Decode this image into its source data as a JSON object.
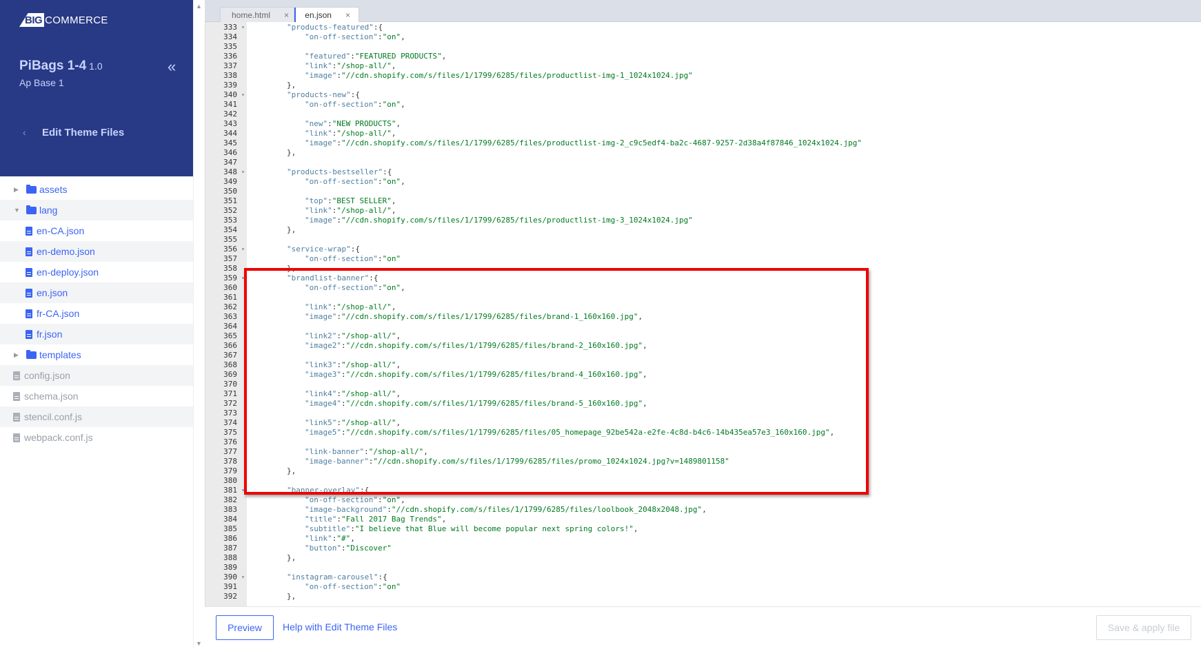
{
  "brand": {
    "logo_big": "BIG",
    "logo_rest": "COMMERCE"
  },
  "store": {
    "name": "PiBags 1-4",
    "version": "1.0",
    "subtitle": "Ap Base 1",
    "collapse_icon": "«"
  },
  "nav": {
    "back_icon": "‹",
    "title": "Edit Theme Files"
  },
  "tree": [
    {
      "label": "assets",
      "type": "folder",
      "state": "collapsed",
      "level": 0
    },
    {
      "label": "lang",
      "type": "folder",
      "state": "expanded",
      "level": 0
    },
    {
      "label": "en-CA.json",
      "type": "file",
      "level": 1
    },
    {
      "label": "en-demo.json",
      "type": "file",
      "level": 1
    },
    {
      "label": "en-deploy.json",
      "type": "file",
      "level": 1
    },
    {
      "label": "en.json",
      "type": "file",
      "level": 1
    },
    {
      "label": "fr-CA.json",
      "type": "file",
      "level": 1
    },
    {
      "label": "fr.json",
      "type": "file",
      "level": 1
    },
    {
      "label": "templates",
      "type": "folder",
      "state": "collapsed",
      "level": 0
    },
    {
      "label": "config.json",
      "type": "file-disabled",
      "level": 0
    },
    {
      "label": "schema.json",
      "type": "file-disabled",
      "level": 0
    },
    {
      "label": "stencil.conf.js",
      "type": "file-disabled",
      "level": 0
    },
    {
      "label": "webpack.conf.js",
      "type": "file-disabled",
      "level": 0
    }
  ],
  "tabs": [
    {
      "label": "home.html",
      "active": false,
      "close": "×"
    },
    {
      "label": "en.json",
      "active": true,
      "close": "×"
    }
  ],
  "code_lines": [
    {
      "n": "333",
      "fold": true,
      "ind": 1,
      "text": "\"products-featured\":{"
    },
    {
      "n": "334",
      "ind": 2,
      "text": "\"on-off-section\":\"on\","
    },
    {
      "n": "335",
      "ind": 0,
      "text": ""
    },
    {
      "n": "336",
      "ind": 2,
      "text": "\"featured\":\"FEATURED PRODUCTS\","
    },
    {
      "n": "337",
      "ind": 2,
      "text": "\"link\":\"/shop-all/\","
    },
    {
      "n": "338",
      "ind": 2,
      "text": "\"image\":\"//cdn.shopify.com/s/files/1/1799/6285/files/productlist-img-1_1024x1024.jpg\""
    },
    {
      "n": "339",
      "ind": 1,
      "text": "},"
    },
    {
      "n": "340",
      "fold": true,
      "ind": 1,
      "text": "\"products-new\":{"
    },
    {
      "n": "341",
      "ind": 2,
      "text": "\"on-off-section\":\"on\","
    },
    {
      "n": "342",
      "ind": 0,
      "text": ""
    },
    {
      "n": "343",
      "ind": 2,
      "text": "\"new\":\"NEW PRODUCTS\","
    },
    {
      "n": "344",
      "ind": 2,
      "text": "\"link\":\"/shop-all/\","
    },
    {
      "n": "345",
      "ind": 2,
      "text": "\"image\":\"//cdn.shopify.com/s/files/1/1799/6285/files/productlist-img-2_c9c5edf4-ba2c-4687-9257-2d38a4f87846_1024x1024.jpg\""
    },
    {
      "n": "346",
      "ind": 1,
      "text": "},"
    },
    {
      "n": "347",
      "ind": 0,
      "text": ""
    },
    {
      "n": "348",
      "fold": true,
      "ind": 1,
      "text": "\"products-bestseller\":{"
    },
    {
      "n": "349",
      "ind": 2,
      "text": "\"on-off-section\":\"on\","
    },
    {
      "n": "350",
      "ind": 0,
      "text": ""
    },
    {
      "n": "351",
      "ind": 2,
      "text": "\"top\":\"BEST SELLER\","
    },
    {
      "n": "352",
      "ind": 2,
      "text": "\"link\":\"/shop-all/\","
    },
    {
      "n": "353",
      "ind": 2,
      "text": "\"image\":\"//cdn.shopify.com/s/files/1/1799/6285/files/productlist-img-3_1024x1024.jpg\""
    },
    {
      "n": "354",
      "ind": 1,
      "text": "},"
    },
    {
      "n": "355",
      "ind": 0,
      "text": ""
    },
    {
      "n": "356",
      "fold": true,
      "ind": 1,
      "text": "\"service-wrap\":{"
    },
    {
      "n": "357",
      "ind": 2,
      "text": "\"on-off-section\":\"on\""
    },
    {
      "n": "358",
      "ind": 1,
      "text": "},"
    },
    {
      "n": "359",
      "fold": true,
      "ind": 1,
      "text": "\"brandlist-banner\":{"
    },
    {
      "n": "360",
      "ind": 2,
      "text": "\"on-off-section\":\"on\","
    },
    {
      "n": "361",
      "ind": 0,
      "text": ""
    },
    {
      "n": "362",
      "ind": 2,
      "text": "\"link\":\"/shop-all/\","
    },
    {
      "n": "363",
      "ind": 2,
      "text": "\"image\":\"//cdn.shopify.com/s/files/1/1799/6285/files/brand-1_160x160.jpg\","
    },
    {
      "n": "364",
      "ind": 0,
      "text": ""
    },
    {
      "n": "365",
      "ind": 2,
      "text": "\"link2\":\"/shop-all/\","
    },
    {
      "n": "366",
      "ind": 2,
      "text": "\"image2\":\"//cdn.shopify.com/s/files/1/1799/6285/files/brand-2_160x160.jpg\","
    },
    {
      "n": "367",
      "ind": 0,
      "text": ""
    },
    {
      "n": "368",
      "ind": 2,
      "text": "\"link3\":\"/shop-all/\","
    },
    {
      "n": "369",
      "ind": 2,
      "text": "\"image3\":\"//cdn.shopify.com/s/files/1/1799/6285/files/brand-4_160x160.jpg\","
    },
    {
      "n": "370",
      "ind": 0,
      "text": ""
    },
    {
      "n": "371",
      "ind": 2,
      "text": "\"link4\":\"/shop-all/\","
    },
    {
      "n": "372",
      "ind": 2,
      "text": "\"image4\":\"//cdn.shopify.com/s/files/1/1799/6285/files/brand-5_160x160.jpg\","
    },
    {
      "n": "373",
      "ind": 0,
      "text": ""
    },
    {
      "n": "374",
      "ind": 2,
      "text": "\"link5\":\"/shop-all/\","
    },
    {
      "n": "375",
      "ind": 2,
      "text": "\"image5\":\"//cdn.shopify.com/s/files/1/1799/6285/files/05_homepage_92be542a-e2fe-4c8d-b4c6-14b435ea57e3_160x160.jpg\","
    },
    {
      "n": "376",
      "ind": 0,
      "text": ""
    },
    {
      "n": "377",
      "ind": 2,
      "text": "\"link-banner\":\"/shop-all/\","
    },
    {
      "n": "378",
      "ind": 2,
      "text": "\"image-banner\":\"//cdn.shopify.com/s/files/1/1799/6285/files/promo_1024x1024.jpg?v=1489801158\""
    },
    {
      "n": "379",
      "ind": 1,
      "text": "},"
    },
    {
      "n": "380",
      "ind": 0,
      "text": ""
    },
    {
      "n": "381",
      "fold": true,
      "ind": 1,
      "text": "\"banner-overlay\":{"
    },
    {
      "n": "382",
      "ind": 2,
      "text": "\"on-off-section\":\"on\","
    },
    {
      "n": "383",
      "ind": 2,
      "text": "\"image-background\":\"//cdn.shopify.com/s/files/1/1799/6285/files/loolbook_2048x2048.jpg\","
    },
    {
      "n": "384",
      "ind": 2,
      "text": "\"title\":\"Fall 2017 Bag Trends\","
    },
    {
      "n": "385",
      "ind": 2,
      "text": "\"subtitle\":\"I believe that Blue will become popular next spring colors!\","
    },
    {
      "n": "386",
      "ind": 2,
      "text": "\"link\":\"#\","
    },
    {
      "n": "387",
      "ind": 2,
      "text": "\"button\":\"Discover\""
    },
    {
      "n": "388",
      "ind": 1,
      "text": "},"
    },
    {
      "n": "389",
      "ind": 0,
      "text": ""
    },
    {
      "n": "390",
      "fold": true,
      "ind": 1,
      "text": "\"instagram-carousel\":{"
    },
    {
      "n": "391",
      "ind": 2,
      "text": "\"on-off-section\":\"on\""
    },
    {
      "n": "392",
      "ind": 1,
      "text": "},"
    }
  ],
  "highlight": {
    "color": "#e00000",
    "from_line": "358",
    "to_line": "380"
  },
  "footer": {
    "preview": "Preview",
    "help": "Help with Edit Theme Files",
    "save": "Save & apply file"
  },
  "colors": {
    "brand": "#283a85",
    "accent": "#3c64f4"
  }
}
